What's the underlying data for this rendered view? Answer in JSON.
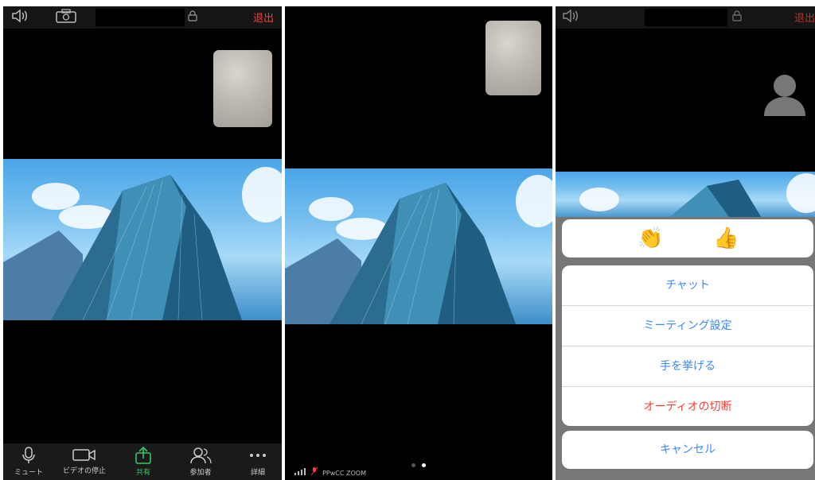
{
  "screens": [
    {
      "topbar": {
        "speaker_icon": "speaker-icon",
        "camera_icon": "camera-flip-icon",
        "lock_icon": "lock-icon",
        "leave_label": "退出"
      },
      "bottombar": [
        {
          "label": "ミュート",
          "icon": "microphone-icon",
          "color": "#cccccc"
        },
        {
          "label": "ビデオの停止",
          "icon": "video-camera-icon",
          "color": "#cccccc"
        },
        {
          "label": "共有",
          "icon": "share-icon",
          "color": "#39c463"
        },
        {
          "label": "参加者",
          "icon": "participants-icon",
          "color": "#cccccc"
        },
        {
          "label": "詳細",
          "icon": "more-icon",
          "color": "#cccccc"
        }
      ]
    },
    {
      "statusbar": {
        "text": "PPwCC ZOOM"
      },
      "page_dots": {
        "count": 2,
        "active": 2
      }
    },
    {
      "topbar": {
        "speaker_icon": "speaker-icon",
        "lock_icon": "lock-icon",
        "leave_label": "退出"
      },
      "reactions": [
        "👏",
        "👍"
      ],
      "menu": [
        {
          "label": "チャット",
          "color": "#3a86ff"
        },
        {
          "label": "ミーティング設定",
          "color": "#3a86ff"
        },
        {
          "label": "手を挙げる",
          "color": "#3a86ff"
        },
        {
          "label": "オーディオの切断",
          "color": "#ff3b30"
        }
      ],
      "cancel_label": "キャンセル"
    }
  ],
  "colors": {
    "leave": "#ff3b30",
    "menu_text": "#3a86ff",
    "share": "#39c463"
  }
}
